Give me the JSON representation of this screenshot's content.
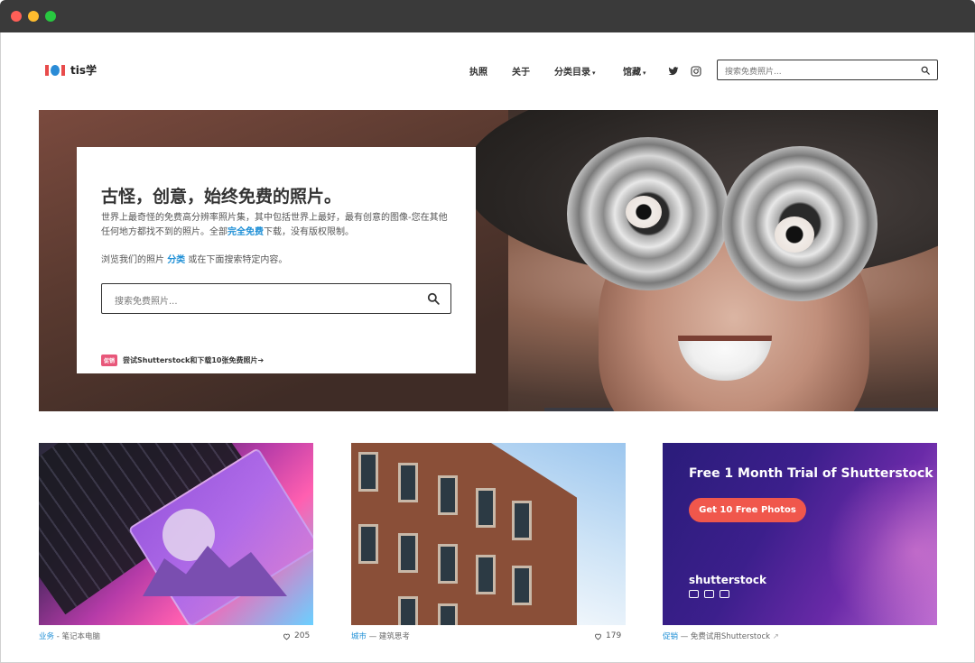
{
  "nav": {
    "logo_text": "tis学",
    "links": [
      {
        "label": "执照"
      },
      {
        "label": "关于"
      },
      {
        "label": "分类目录",
        "caret": "▾"
      },
      {
        "label": "馆藏",
        "caret": "▾"
      }
    ],
    "social": [
      "twitter-icon",
      "instagram-icon"
    ],
    "search_placeholder": "搜索免费照片..."
  },
  "hero": {
    "title": "古怪，创意，始终免费的照片。",
    "desc_part1": "世界上最奇怪的免费高分辨率照片集，其中包括世界上最好，最有创意的图像-您在其他任何地方都找不到的照片。全部",
    "desc_highlight": "完全免费",
    "desc_part2": "下载，没有版权限制。",
    "browse_part1": "浏览我们的照片 ",
    "browse_highlight": "分类",
    "browse_part2": " 或在下面搜索特定内容。",
    "search_placeholder": "搜索免费照片...",
    "badge": "促销",
    "promo_link": "尝试Shutterstock和下载10张免费照片➔"
  },
  "thumbs": [
    {
      "category": "业务",
      "separator": " - ",
      "title": "笔记本电脑",
      "likes": "205"
    },
    {
      "category": "城市",
      "separator": " — ",
      "title": "建筑思考",
      "likes": "179"
    },
    {
      "category": "促销",
      "separator": " — ",
      "title": "免费试用Shutterstock",
      "external": "↗"
    }
  ],
  "promo_card": {
    "title": "Free 1 Month Trial of Shutterstock",
    "button": "Get 10 Free Photos",
    "brand": "shutterstock"
  },
  "colors": {
    "accent": "#1e8fd6",
    "badge": "#e8577a",
    "promo_button": "#f0574c"
  }
}
